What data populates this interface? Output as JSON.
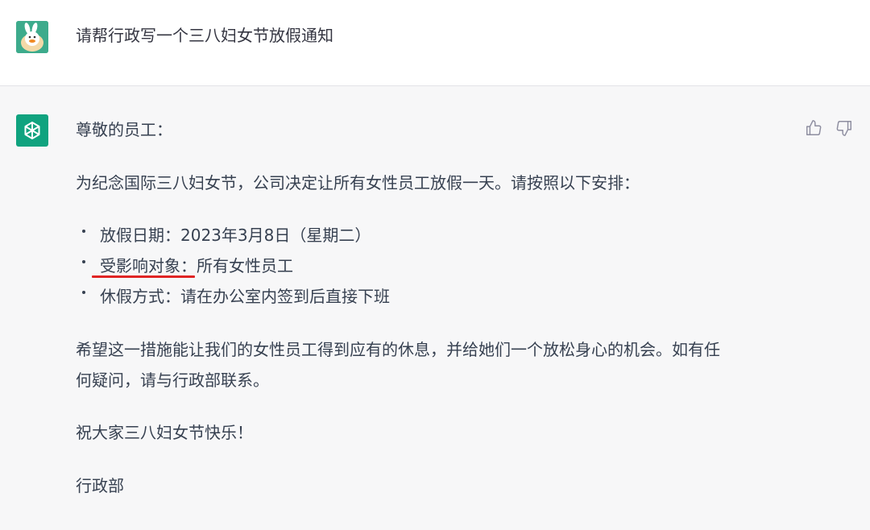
{
  "user": {
    "avatar": "duck-avatar",
    "message": "请帮行政写一个三八妇女节放假通知"
  },
  "assistant": {
    "avatar": "openai-logo-icon",
    "greeting": "尊敬的员工：",
    "intro": "为纪念国际三八妇女节，公司决定让所有女性员工放假一天。请按照以下安排：",
    "bullets": [
      {
        "text": "放假日期：2023年3月8日（星期二）"
      },
      {
        "text": "受影响对象：所有女性员工"
      },
      {
        "text": "休假方式：请在办公室内签到后直接下班"
      }
    ],
    "para_line1": "希望这一措施能让我们的女性员工得到应有的休息，并给她们一个放松身心的机会。如有任",
    "para_line2": "何疑问，请与行政部联系。",
    "wish": "祝大家三八妇女节快乐！",
    "signature": "行政部"
  },
  "feedback": {
    "thumbs_up": "thumbs-up-icon",
    "thumbs_down": "thumbs-down-icon"
  },
  "colors": {
    "assistant_bg": "#f7f7f8",
    "openai_green": "#10a37f",
    "user_avatar_bg": "#3dab8c",
    "annotation_red": "#e02424"
  }
}
